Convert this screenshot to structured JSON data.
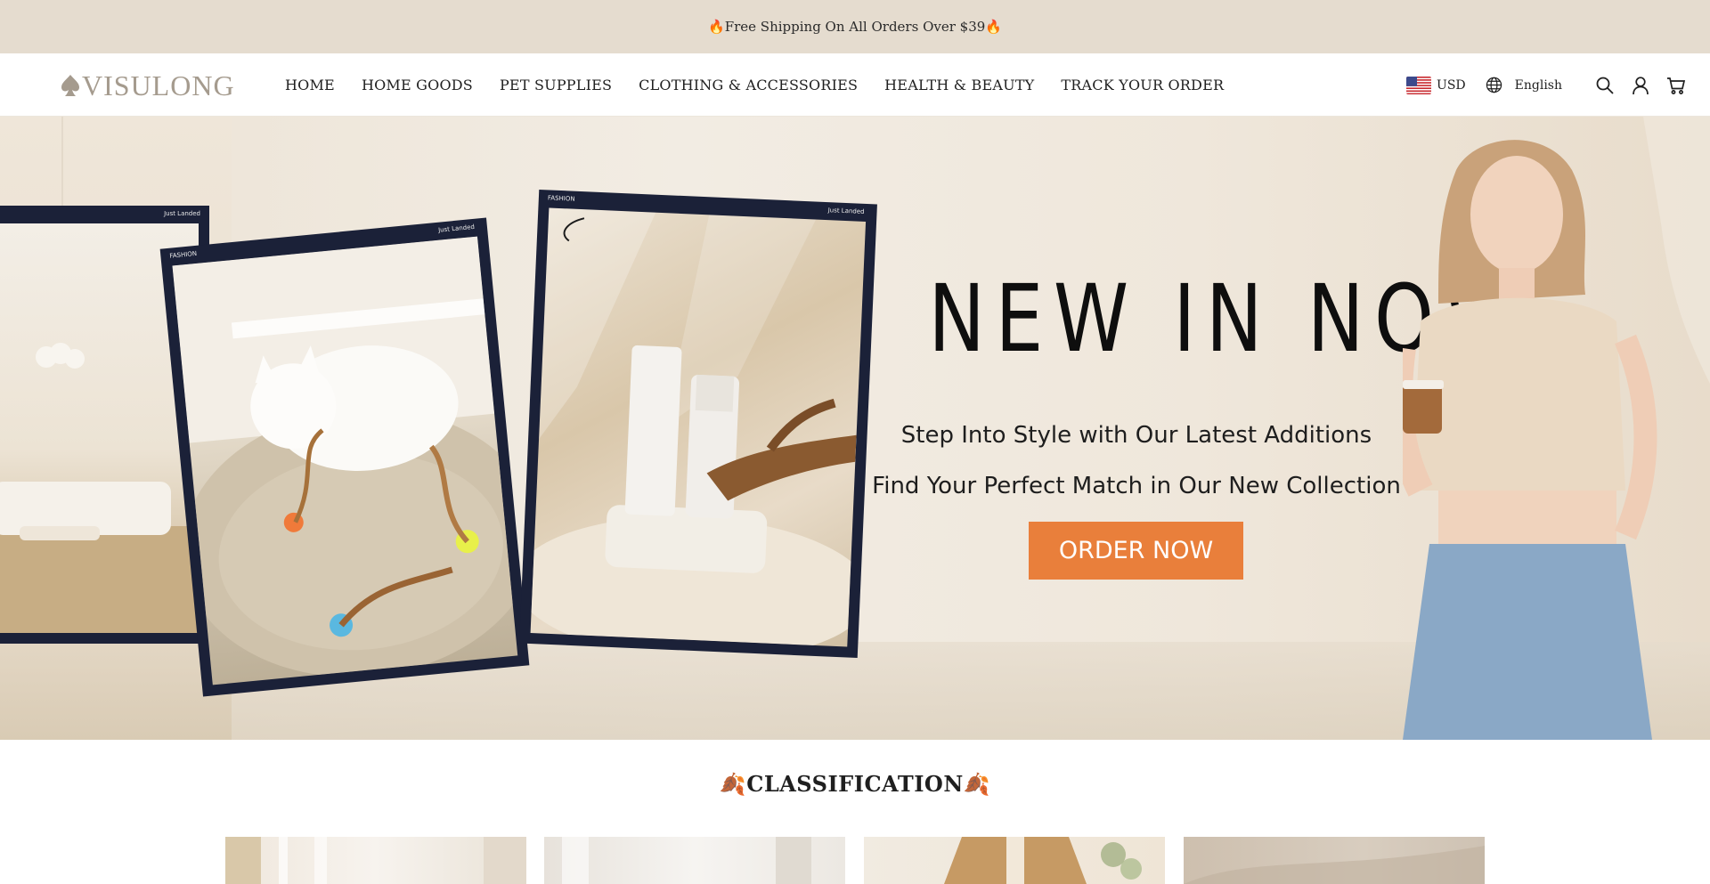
{
  "announcement": {
    "text": "🔥Free Shipping On All Orders Over $39🔥"
  },
  "header": {
    "logo_text": "VISULONG",
    "nav": [
      {
        "label": "HOME"
      },
      {
        "label": "HOME GOODS"
      },
      {
        "label": "PET SUPPLIES"
      },
      {
        "label": "CLOTHING & ACCESSORIES"
      },
      {
        "label": "HEALTH & BEAUTY"
      },
      {
        "label": "TRACK YOUR ORDER"
      }
    ],
    "currency": "USD",
    "language": "English",
    "icons": [
      "globe-icon",
      "search-icon",
      "account-icon",
      "cart-icon"
    ]
  },
  "hero": {
    "frame_tags": [
      "Just Landed",
      "FASHION",
      "Just Landed",
      "FASHION",
      "Just Landed"
    ],
    "title": "NEW IN NOW",
    "line1": "Step Into Style with Our Latest Additions",
    "line2": "Find Your Perfect Match in Our New Collection",
    "cta": "ORDER NOW"
  },
  "classification": {
    "title": "🍂CLASSIFICATION🍂",
    "cards": [
      {
        "name": "curtains-card"
      },
      {
        "name": "linen-card"
      },
      {
        "name": "coat-card"
      },
      {
        "name": "fabric-card"
      }
    ]
  },
  "colors": {
    "announcement_bg": "#e5dccf",
    "cta": "#e97f3b",
    "frame": "#1b2138",
    "logo": "#a59b8e"
  }
}
